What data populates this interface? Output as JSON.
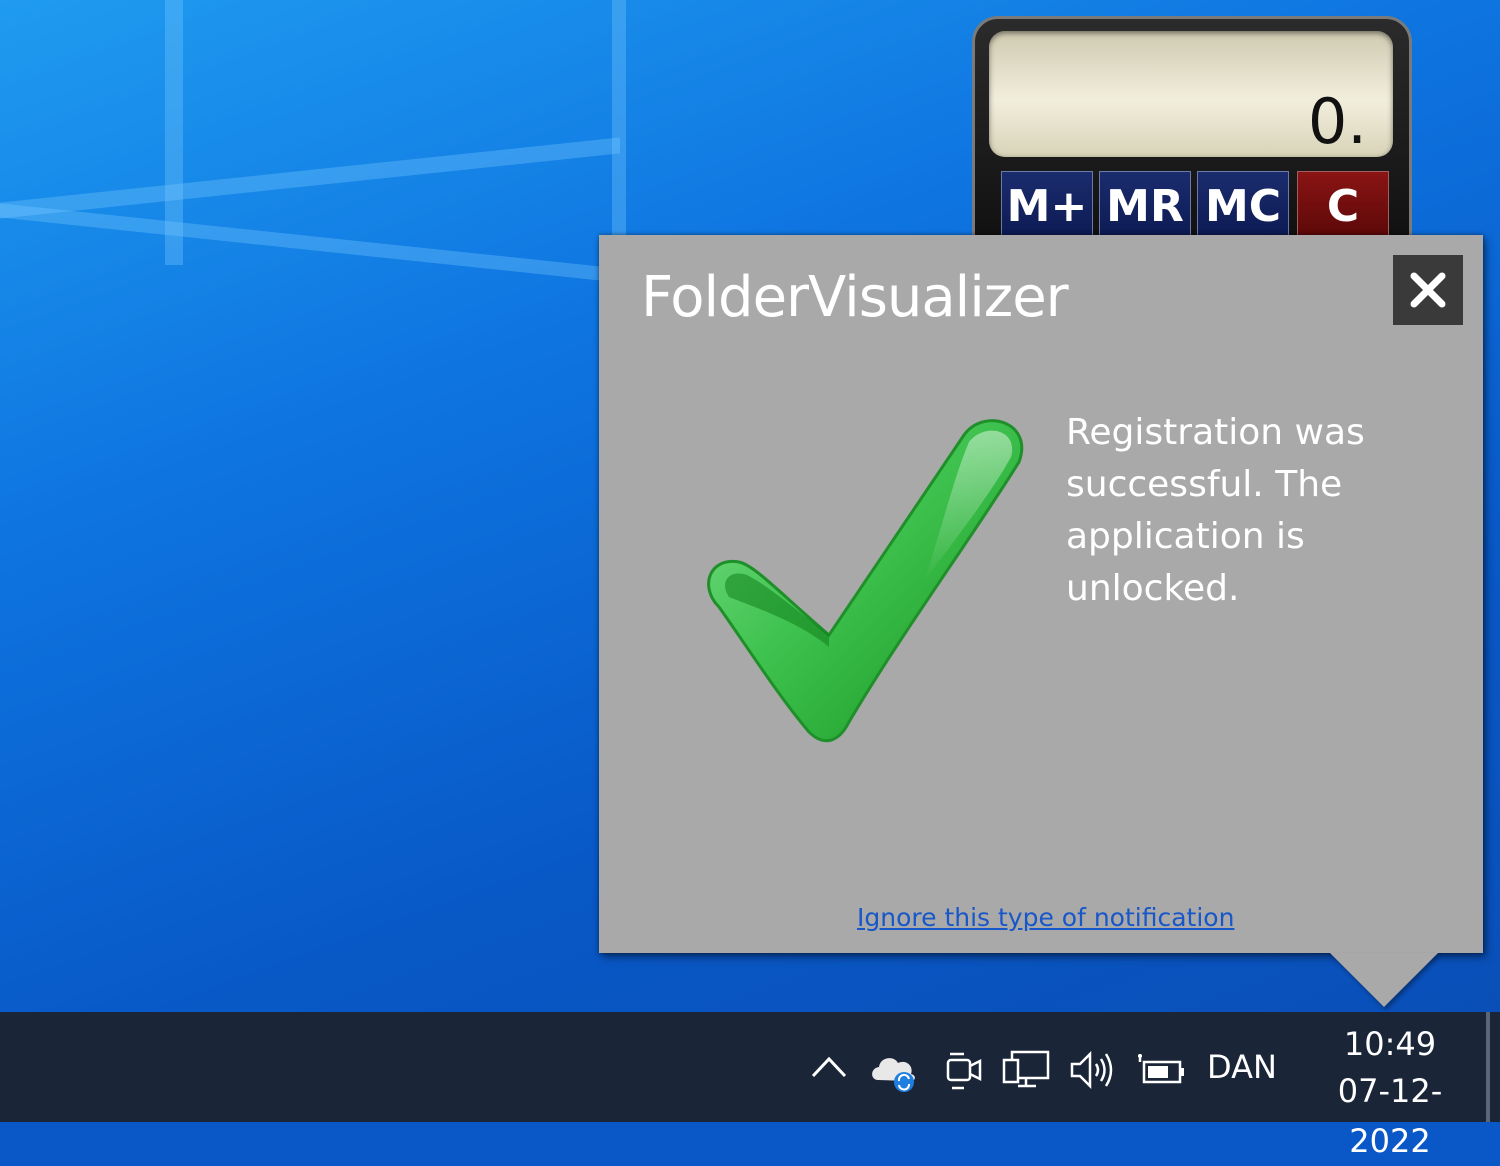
{
  "calculator": {
    "display": "0.",
    "buttons": [
      "M+",
      "MR",
      "MC",
      "C"
    ]
  },
  "notification": {
    "title": "FolderVisualizer",
    "message": "Registration was successful. The application is unlocked.",
    "ignore_link": "Ignore this type of notification",
    "close_icon": "close-icon",
    "status_icon": "checkmark-icon"
  },
  "taskbar": {
    "tray_icons": [
      "chevron-up-icon",
      "onedrive-sync-icon",
      "meet-now-icon",
      "network-icon",
      "volume-icon",
      "battery-icon"
    ],
    "language": "DAN",
    "time": "10:49",
    "date": "07-12-2022"
  },
  "colors": {
    "popup_bg": "#a9a9a9",
    "link": "#1857c9",
    "taskbar": "#1a2538",
    "check_green": "#2fb34a"
  }
}
